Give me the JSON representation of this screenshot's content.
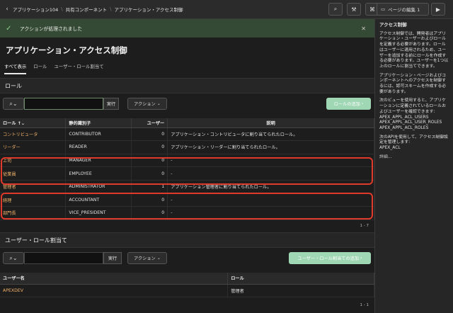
{
  "breadcrumbs": [
    "アプリケーション104",
    "共有コンポーネント",
    "アプリケーション・アクセス制御"
  ],
  "toolbar": {
    "edit_label": "ページの編集 1"
  },
  "success": {
    "message": "アクションが処理されました"
  },
  "page_title": "アプリケーション・アクセス制御",
  "tabs": [
    {
      "label": "すべて表示",
      "active": true
    },
    {
      "label": "ロール"
    },
    {
      "label": "ユーザー・ロール割当て"
    }
  ],
  "roles": {
    "title": "ロール",
    "go_label": "実行",
    "actions_label": "アクション",
    "add_label": "ロールの追加",
    "columns": [
      "ロール",
      "静的識別子",
      "ユーザー",
      "説明"
    ],
    "rows": [
      [
        "コントリビュータ",
        "CONTRIBUTOR",
        "0",
        "アプリケーション・コントリビュータに割り当てられたロール。"
      ],
      [
        "リーダー",
        "READER",
        "0",
        "アプリケーション・リーダーに割り当てられたロール。"
      ],
      [
        "上司",
        "MANAGER",
        "0",
        "-"
      ],
      [
        "従業員",
        "EMPLOYEE",
        "0",
        "-"
      ],
      [
        "管理者",
        "ADMINISTRATOR",
        "1",
        "アプリケーション管理者に割り当てられたロール。"
      ],
      [
        "経理",
        "ACCOUNTANT",
        "0",
        "-"
      ],
      [
        "部門長",
        "VICE_PRESIDENT",
        "0",
        "-"
      ]
    ],
    "pagination": "1 - 7"
  },
  "assignments": {
    "title": "ユーザー・ロール割当て",
    "go_label": "実行",
    "actions_label": "アクション",
    "add_label": "ユーザー・ロール割当ての追加",
    "columns": [
      "ユーザー名",
      "ロール"
    ],
    "rows": [
      [
        "APEXDEV",
        "管理者"
      ]
    ],
    "pagination": "1 - 1"
  },
  "sidebar": {
    "title": "アクセス制御",
    "p1": "アクセス制御では、開発者はアプリケーション・ユーザーおよびロールを定義する必要があります。ロールはユーザーに適用されるため、ユーザーを追加する前にロールを作成する必要があります。ユーザーを1つ以上のロールに割当てできます。",
    "p2": "アプリケーション・ページおよびコンポーネントへのアクセスを制御するには、認可スキームを作成する必要があります。",
    "p3": "次のビューを使用すると、アプリケーションに定義されているロールおよびユーザーを確認できます:",
    "views": [
      "APEX_APPL_ACL_USERS",
      "APEX_APPL_ACL_USER_ROLES",
      "APEX_APPL_ACL_ROLES"
    ],
    "p4": "次のAPIを使用して、アクセス制御設定を管理します:",
    "api": "APEX_ACL",
    "more": "詳細..."
  }
}
